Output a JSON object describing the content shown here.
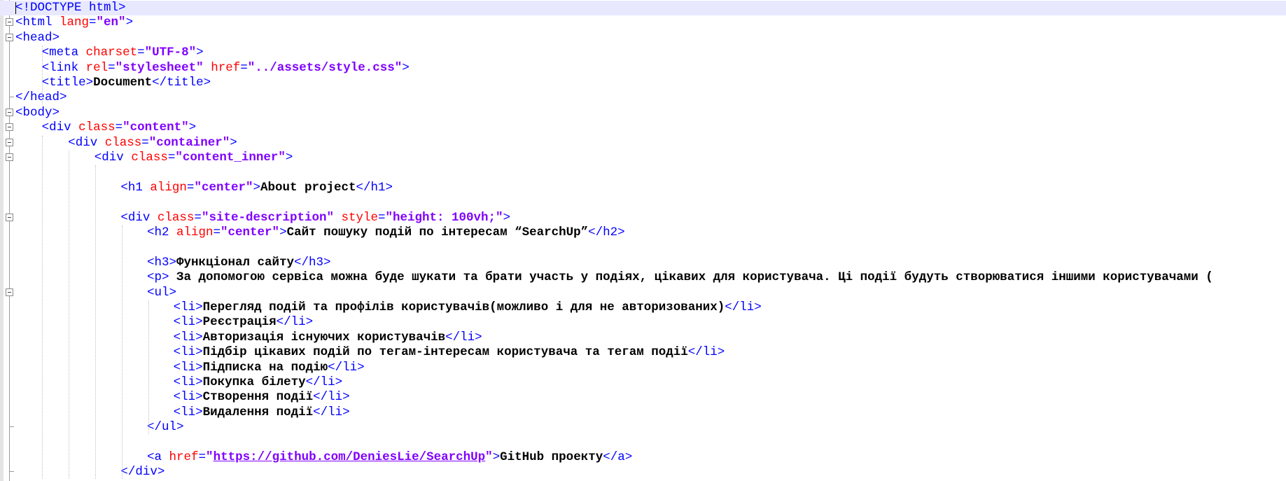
{
  "editor": {
    "colors": {
      "tag": "#0000ff",
      "attribute": "#ff0000",
      "value": "#8000ff",
      "text": "#000000",
      "current_line": "#e8e8ff"
    },
    "lines": [
      {
        "indent": 0,
        "fold": "none",
        "current": true,
        "tokens": [
          [
            "d",
            "<!DOCTYPE html>"
          ]
        ]
      },
      {
        "indent": 0,
        "fold": "open",
        "tokens": [
          [
            "t",
            "<html "
          ],
          [
            "a",
            "lang"
          ],
          [
            "t",
            "="
          ],
          [
            "v",
            "\"en\""
          ],
          [
            "t",
            ">"
          ]
        ]
      },
      {
        "indent": 0,
        "fold": "open",
        "tokens": [
          [
            "t",
            "<head>"
          ]
        ]
      },
      {
        "indent": 1,
        "fold": "none",
        "tokens": [
          [
            "t",
            "<meta "
          ],
          [
            "a",
            "charset"
          ],
          [
            "t",
            "="
          ],
          [
            "v",
            "\"UTF-8\""
          ],
          [
            "t",
            ">"
          ]
        ]
      },
      {
        "indent": 1,
        "fold": "none",
        "tokens": [
          [
            "t",
            "<link "
          ],
          [
            "a",
            "rel"
          ],
          [
            "t",
            "="
          ],
          [
            "v",
            "\"stylesheet\""
          ],
          [
            "t",
            " "
          ],
          [
            "a",
            "href"
          ],
          [
            "t",
            "="
          ],
          [
            "v",
            "\"../assets/style.css\""
          ],
          [
            "t",
            ">"
          ]
        ]
      },
      {
        "indent": 1,
        "fold": "none",
        "tokens": [
          [
            "t",
            "<title>"
          ],
          [
            "x",
            "Document"
          ],
          [
            "t",
            "</title>"
          ]
        ]
      },
      {
        "indent": 0,
        "fold": "end",
        "tokens": [
          [
            "t",
            "</head>"
          ]
        ]
      },
      {
        "indent": 0,
        "fold": "open",
        "tokens": [
          [
            "t",
            "<body>"
          ]
        ]
      },
      {
        "indent": 1,
        "fold": "open",
        "tokens": [
          [
            "t",
            "<div "
          ],
          [
            "a",
            "class"
          ],
          [
            "t",
            "="
          ],
          [
            "v",
            "\"content\""
          ],
          [
            "t",
            ">"
          ]
        ]
      },
      {
        "indent": 2,
        "fold": "open",
        "tokens": [
          [
            "t",
            "<div "
          ],
          [
            "a",
            "class"
          ],
          [
            "t",
            "="
          ],
          [
            "v",
            "\"container\""
          ],
          [
            "t",
            ">"
          ]
        ]
      },
      {
        "indent": 3,
        "fold": "open",
        "tokens": [
          [
            "t",
            "<div "
          ],
          [
            "a",
            "class"
          ],
          [
            "t",
            "="
          ],
          [
            "v",
            "\"content_inner\""
          ],
          [
            "t",
            ">"
          ]
        ]
      },
      {
        "indent": 0,
        "fold": "none",
        "tokens": []
      },
      {
        "indent": 4,
        "fold": "none",
        "tokens": [
          [
            "t",
            "<h1 "
          ],
          [
            "a",
            "align"
          ],
          [
            "t",
            "="
          ],
          [
            "v",
            "\"center\""
          ],
          [
            "t",
            ">"
          ],
          [
            "x",
            "About project"
          ],
          [
            "t",
            "</h1>"
          ]
        ]
      },
      {
        "indent": 0,
        "fold": "none",
        "tokens": []
      },
      {
        "indent": 4,
        "fold": "open",
        "tokens": [
          [
            "t",
            "<div "
          ],
          [
            "a",
            "class"
          ],
          [
            "t",
            "="
          ],
          [
            "v",
            "\"site-description\""
          ],
          [
            "t",
            " "
          ],
          [
            "a",
            "style"
          ],
          [
            "t",
            "="
          ],
          [
            "v",
            "\"height: 100vh;\""
          ],
          [
            "t",
            ">"
          ]
        ]
      },
      {
        "indent": 5,
        "fold": "none",
        "tokens": [
          [
            "t",
            "<h2 "
          ],
          [
            "a",
            "align"
          ],
          [
            "t",
            "="
          ],
          [
            "v",
            "\"center\""
          ],
          [
            "t",
            ">"
          ],
          [
            "x",
            "Сайт пошуку подій по інтересам “SearchUp”"
          ],
          [
            "t",
            "</h2>"
          ]
        ]
      },
      {
        "indent": 0,
        "fold": "none",
        "tokens": []
      },
      {
        "indent": 5,
        "fold": "none",
        "tokens": [
          [
            "t",
            "<h3>"
          ],
          [
            "x",
            "Функціонал сайту"
          ],
          [
            "t",
            "</h3>"
          ]
        ]
      },
      {
        "indent": 5,
        "fold": "none",
        "tokens": [
          [
            "t",
            "<p>"
          ],
          [
            "x",
            " За допомогою сервіса можна буде шукати та брати участь у подіях, цікавих для користувача. Ці події будуть створюватися іншими користувачами ("
          ]
        ]
      },
      {
        "indent": 5,
        "fold": "open",
        "tokens": [
          [
            "t",
            "<ul>"
          ]
        ]
      },
      {
        "indent": 6,
        "fold": "none",
        "tokens": [
          [
            "t",
            "<li>"
          ],
          [
            "x",
            "Перегляд подій та профілів користувачів(можливо і для не авторизованих)"
          ],
          [
            "t",
            "</li>"
          ]
        ]
      },
      {
        "indent": 6,
        "fold": "none",
        "tokens": [
          [
            "t",
            "<li>"
          ],
          [
            "x",
            "Реєстрація"
          ],
          [
            "t",
            "</li>"
          ]
        ]
      },
      {
        "indent": 6,
        "fold": "none",
        "tokens": [
          [
            "t",
            "<li>"
          ],
          [
            "x",
            "Авторизація існуючих користувачів"
          ],
          [
            "t",
            "</li>"
          ]
        ]
      },
      {
        "indent": 6,
        "fold": "none",
        "tokens": [
          [
            "t",
            "<li>"
          ],
          [
            "x",
            "Підбір цікавих подій по тегам-інтересам користувача та тегам події"
          ],
          [
            "t",
            "</li>"
          ]
        ]
      },
      {
        "indent": 6,
        "fold": "none",
        "tokens": [
          [
            "t",
            "<li>"
          ],
          [
            "x",
            "Підписка на подію"
          ],
          [
            "t",
            "</li>"
          ]
        ]
      },
      {
        "indent": 6,
        "fold": "none",
        "tokens": [
          [
            "t",
            "<li>"
          ],
          [
            "x",
            "Покупка білету"
          ],
          [
            "t",
            "</li>"
          ]
        ]
      },
      {
        "indent": 6,
        "fold": "none",
        "tokens": [
          [
            "t",
            "<li>"
          ],
          [
            "x",
            "Створення події"
          ],
          [
            "t",
            "</li>"
          ]
        ]
      },
      {
        "indent": 6,
        "fold": "none",
        "tokens": [
          [
            "t",
            "<li>"
          ],
          [
            "x",
            "Видалення події"
          ],
          [
            "t",
            "</li>"
          ]
        ]
      },
      {
        "indent": 5,
        "fold": "end",
        "tokens": [
          [
            "t",
            "</ul>"
          ]
        ]
      },
      {
        "indent": 0,
        "fold": "none",
        "tokens": []
      },
      {
        "indent": 5,
        "fold": "none",
        "tokens": [
          [
            "t",
            "<a "
          ],
          [
            "a",
            "href"
          ],
          [
            "t",
            "="
          ],
          [
            "v",
            "\""
          ],
          [
            "u",
            "https://github.com/DeniesLie/SearchUp"
          ],
          [
            "v",
            "\""
          ],
          [
            "t",
            ">"
          ],
          [
            "x",
            "GitHub проекту"
          ],
          [
            "t",
            "</a>"
          ]
        ]
      },
      {
        "indent": 4,
        "fold": "end",
        "tokens": [
          [
            "t",
            "</div>"
          ]
        ]
      }
    ]
  }
}
